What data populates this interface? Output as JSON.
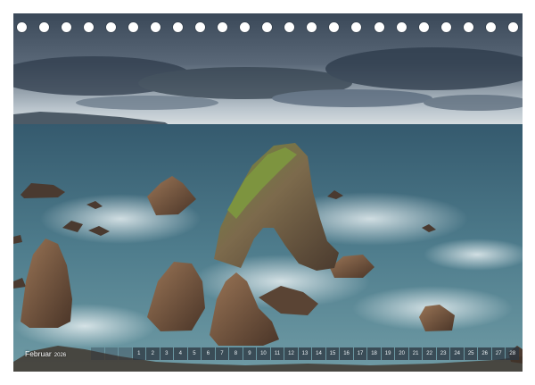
{
  "calendar": {
    "month": "Februar",
    "year": "2026",
    "days": [
      "",
      "",
      "",
      "1",
      "2",
      "3",
      "4",
      "5",
      "6",
      "7",
      "8",
      "9",
      "10",
      "11",
      "12",
      "13",
      "14",
      "15",
      "16",
      "17",
      "18",
      "19",
      "20",
      "21",
      "22",
      "23",
      "24",
      "25",
      "26",
      "27",
      "28"
    ]
  },
  "binding": {
    "hole_count": 23
  },
  "colors": {
    "sky_dark": "#3b4a5c",
    "sky_light": "#c9d2d8",
    "sea": "#3c6478",
    "rock": "#7a5a44",
    "moss": "#6f8a3a"
  }
}
